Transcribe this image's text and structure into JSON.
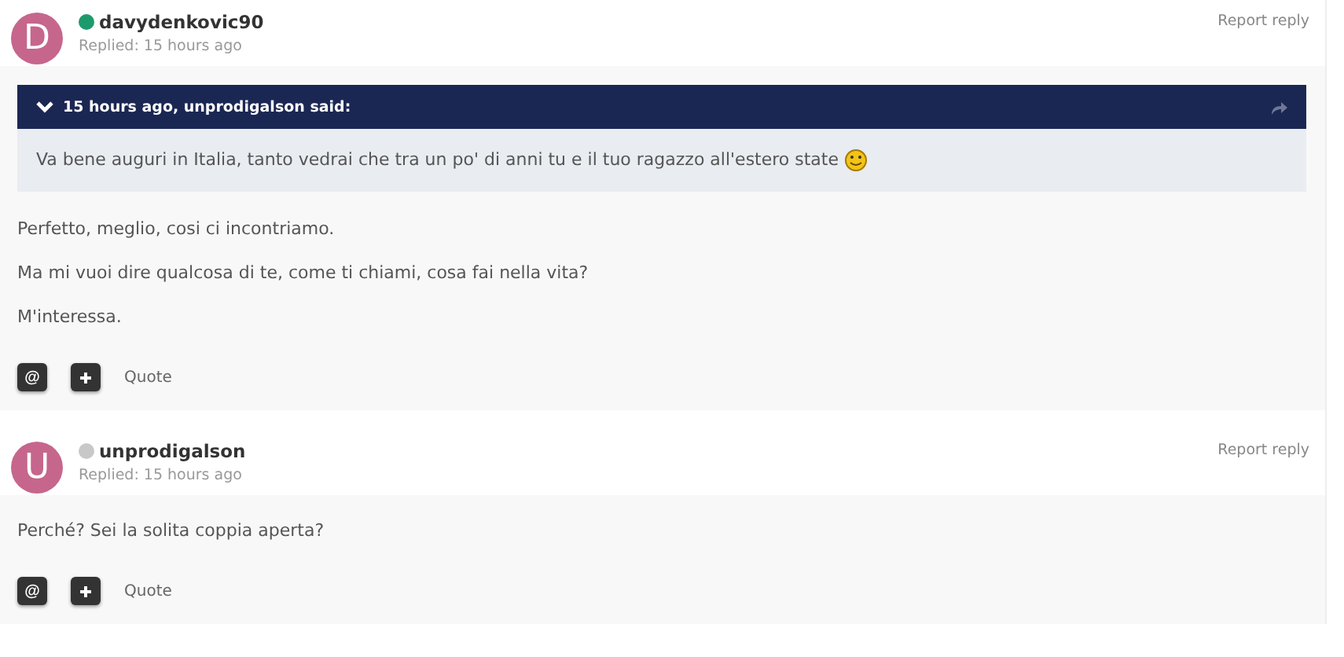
{
  "posts": [
    {
      "avatar": "D",
      "author": "davydenkovic90",
      "online": true,
      "replied": "Replied: 15 hours ago",
      "report": "Report reply",
      "quote": {
        "header": "15 hours ago, unprodigalson said:",
        "text": "Va bene auguri in Italia, tanto vedrai che tra un po' di anni tu e il tuo ragazzo all'estero state"
      },
      "paragraphs": [
        "Perfetto, meglio, cosi ci incontriamo.",
        "Ma mi vuoi dire qualcosa di te, come ti chiami, cosa fai nella vita?",
        "M'interessa."
      ],
      "mention": "@",
      "quote_label": "Quote"
    },
    {
      "avatar": "U",
      "author": "unprodigalson",
      "online": false,
      "replied": "Replied: 15 hours ago",
      "report": "Report reply",
      "paragraphs": [
        "Perché? Sei la solita coppia aperta?"
      ],
      "mention": "@",
      "quote_label": "Quote"
    }
  ]
}
